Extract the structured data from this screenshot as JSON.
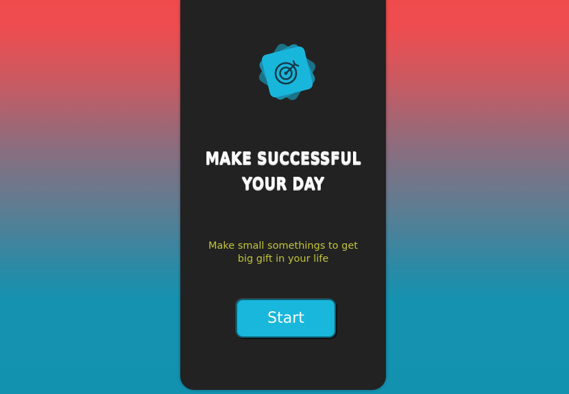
{
  "brand": {
    "accent": "#19b6dc",
    "panel_bg": "#222222",
    "subtitle_color": "#c2c53a",
    "logo_icon": "target-icon"
  },
  "hero": {
    "title_line1": "MAKE SUCCESSFUL",
    "title_line2": "YOUR DAY",
    "subtitle_line1": "Make small somethings to get",
    "subtitle_line2": "big gift in your life"
  },
  "actions": {
    "start_label": "Start"
  }
}
